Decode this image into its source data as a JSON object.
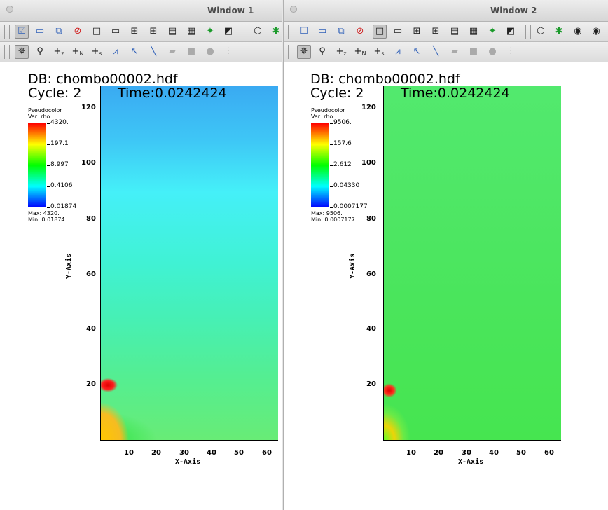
{
  "windows": [
    {
      "title": "Window 1",
      "annotations": {
        "db": "DB: chombo00002.hdf",
        "cycle": "Cycle: 2",
        "time": "Time:0.0242424"
      },
      "legend": {
        "plot_type": "Pseudocolor",
        "var": "Var: rho",
        "tick_labels": [
          "4320.",
          "197.1",
          "8.997",
          "0.4106",
          "0.01874"
        ],
        "max": "Max:  4320.",
        "min": "Min:  0.01874"
      },
      "axes": {
        "xlabel": "X-Axis",
        "ylabel": "Y-Axis",
        "x_ticks": [
          "10",
          "20",
          "30",
          "40",
          "50",
          "60"
        ],
        "y_ticks": [
          "120",
          "100",
          "80",
          "60",
          "40",
          "20"
        ]
      }
    },
    {
      "title": "Window 2",
      "annotations": {
        "db": "DB: chombo00002.hdf",
        "cycle": "Cycle: 2",
        "time": "Time:0.0242424"
      },
      "legend": {
        "plot_type": "Pseudocolor",
        "var": "Var: rho",
        "tick_labels": [
          "9506.",
          "157.6",
          "2.612",
          "0.04330",
          "0.0007177"
        ],
        "max": "Max:  9506.",
        "min": "Min:  0.0007177"
      },
      "axes": {
        "xlabel": "X-Axis",
        "ylabel": "Y-Axis",
        "x_ticks": [
          "10",
          "20",
          "30",
          "40",
          "50",
          "60"
        ],
        "y_ticks": [
          "120",
          "100",
          "80",
          "60",
          "40",
          "20"
        ]
      }
    }
  ],
  "toolbar_icons_row1": [
    "active-window-icon",
    "new-window-icon",
    "clone-window-icon",
    "delete-window-icon",
    "layout-1x1-icon",
    "layout-1x2-icon",
    "layout-2x2-icon",
    "layout-2x3-icon",
    "layout-2x4-icon",
    "layout-3x3-icon",
    "lock-tools-icon",
    "invert-colors-icon",
    "toggle-3d-icon",
    "spin-icon",
    "save-image-icon",
    "print-icon"
  ],
  "toolbar_icons_row2": [
    "navigate-icon",
    "zoom-icon",
    "pick-zone-icon",
    "pick-node-icon",
    "pick-spreadsheet-icon",
    "lineout-icon",
    "pick-line-icon",
    "line-tool-icon",
    "plane-tool-icon",
    "box-tool-icon",
    "sphere-tool-icon",
    "point-tool-icon"
  ],
  "colors": {
    "titlebar": "#e0e0e0",
    "legend_top": "#ff0000",
    "legend_bottom": "#0000ff"
  }
}
